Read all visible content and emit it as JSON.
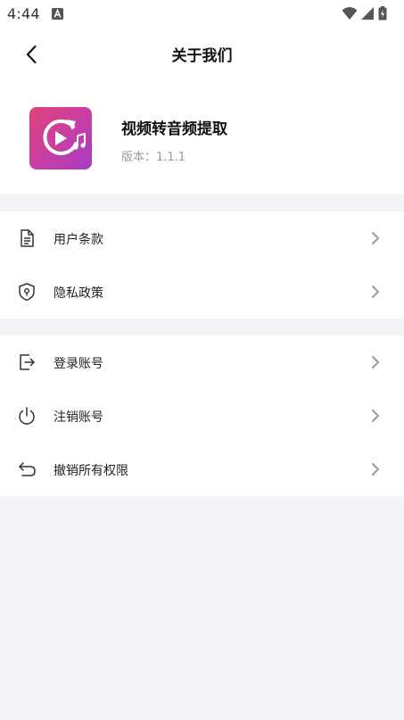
{
  "status_bar": {
    "time": "4:44",
    "notification_icon": "a-box-icon",
    "right_icons": [
      "wifi-icon",
      "signal-icon",
      "battery-icon"
    ]
  },
  "header": {
    "back_icon": "chevron-left-icon",
    "title": "关于我们"
  },
  "app": {
    "name": "视频转音频提取",
    "version": "版本：1.1.1",
    "icon": "video-to-audio-icon",
    "icon_colors": [
      "#e0427a",
      "#a63cc4"
    ]
  },
  "groups": [
    {
      "items": [
        {
          "label": "用户条款",
          "icon": "document-icon"
        },
        {
          "label": "隐私政策",
          "icon": "shield-icon"
        }
      ]
    },
    {
      "items": [
        {
          "label": "登录账号",
          "icon": "login-icon"
        },
        {
          "label": "注销账号",
          "icon": "power-icon"
        },
        {
          "label": "撤销所有权限",
          "icon": "undo-icon"
        }
      ]
    }
  ],
  "colors": {
    "background": "#f3f4f8",
    "card": "#ffffff",
    "text": "#222222",
    "secondary_text": "#9a9a9a",
    "chevron": "#9b9b9b"
  }
}
